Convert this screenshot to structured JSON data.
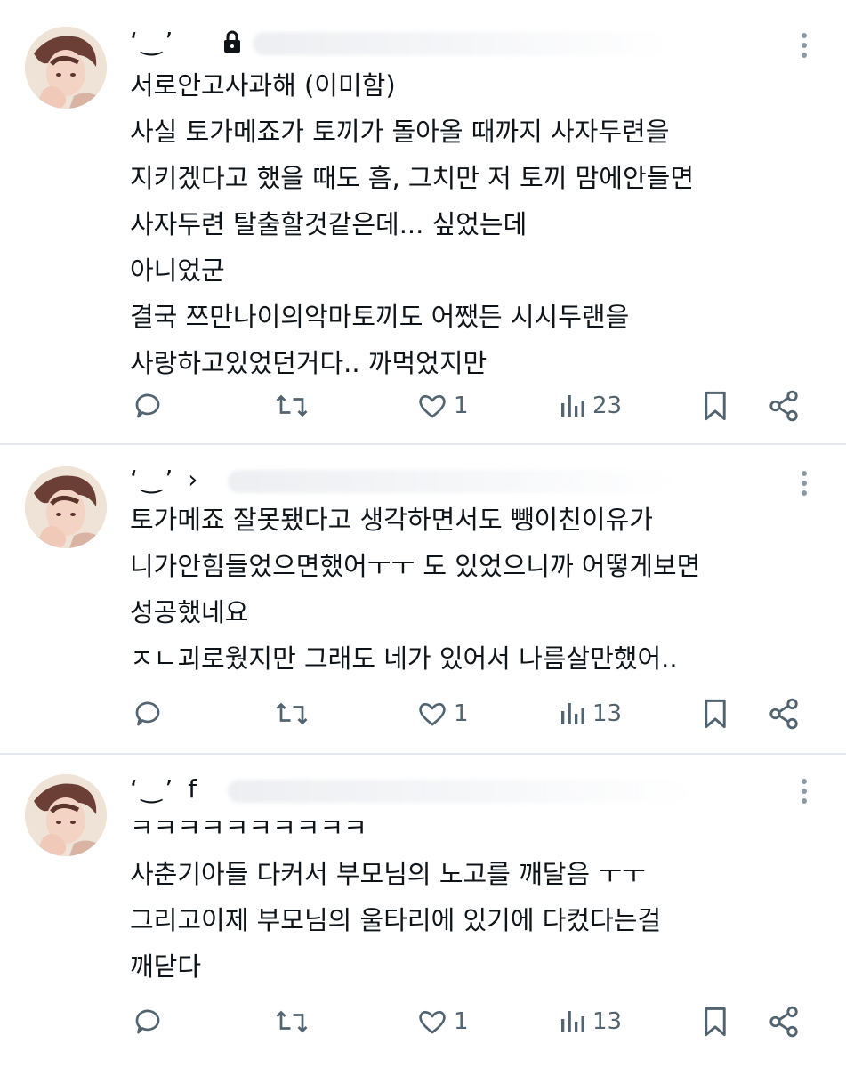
{
  "tweets": [
    {
      "body": "서로안고사과해 (이미함)\n사실 토가메죠가 토끼가 돌아올 때까지 사자두련을\n지키겠다고 했을 때도 흠, 그치만 저 토끼 맘에안들면\n사자두련 탈출할것같은데... 싶었는데\n아니었군\n결국 쯔만나이의악마토끼도 어쨌든 시시두랜을\n사랑하고있었던거다.. 까먹었지만",
      "likes": "1",
      "views": "23",
      "locked": true
    },
    {
      "body": "토가메죠 잘못됐다고 생각하면서도 뺑이친이유가\n니가안힘들었으면했어ㅜㅜ 도 있었으니까 어떻게보면\n성공했네요\nㅈㄴ괴로웠지만 그래도 네가 있어서 나름살만했어..",
      "likes": "1",
      "views": "13",
      "locked": false
    },
    {
      "body": "ㅋㅋㅋㅋㅋㅋㅋㅋㅋㅋ\n사춘기아들 다커서 부모님의 노고를 깨달음 ㅜㅜ\n그리고이제 부모님의 울타리에 있기에 다컸다는걸\n깨닫다",
      "likes": "1",
      "views": "13",
      "locked": false
    }
  ],
  "icons": {
    "reply": "reply-icon",
    "retweet": "retweet-icon",
    "like": "heart-icon",
    "views": "views-icon",
    "bookmark": "bookmark-icon",
    "share": "share-icon",
    "more": "more-vertical-icon",
    "lock": "lock-icon"
  },
  "colors": {
    "text": "#0f1419",
    "icon": "#536471",
    "divider": "#e4e8ec"
  }
}
